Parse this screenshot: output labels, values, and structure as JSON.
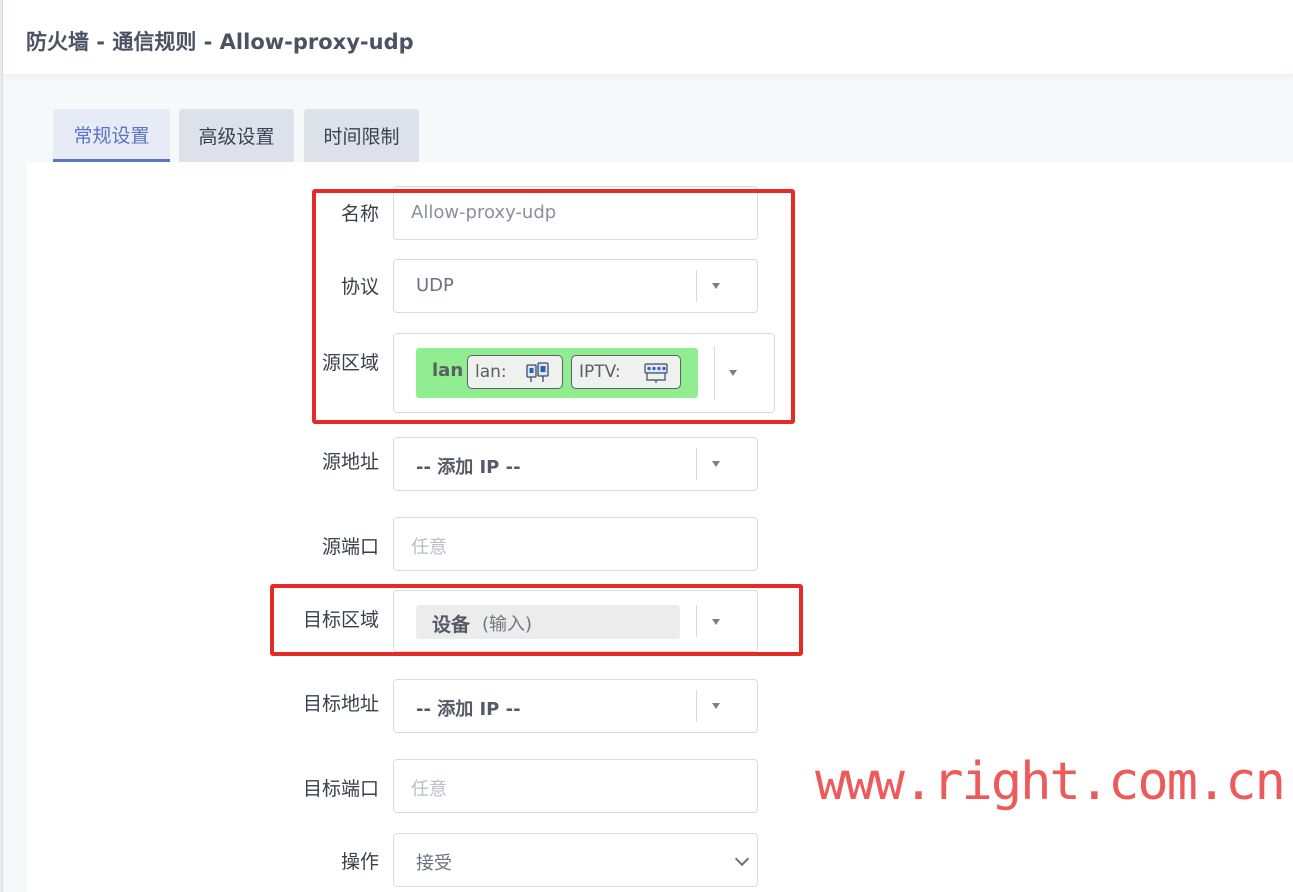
{
  "modal": {
    "title": "防火墙 - 通信规则 - Allow-proxy-udp"
  },
  "tabs": [
    {
      "label": "常规设置",
      "active": true
    },
    {
      "label": "高级设置",
      "active": false
    },
    {
      "label": "时间限制",
      "active": false
    }
  ],
  "form": {
    "name": {
      "label": "名称",
      "value": "Allow-proxy-udp"
    },
    "protocol": {
      "label": "协议",
      "value": "UDP"
    },
    "source_zone": {
      "label": "源区域",
      "zone": "lan",
      "color": "#90ee90",
      "networks": [
        {
          "name": "lan:",
          "icon": "ethernet-port-icon"
        },
        {
          "name": "IPTV:",
          "icon": "ethernet-switch-icon"
        }
      ]
    },
    "source_address": {
      "label": "源地址",
      "value": "-- 添加 IP --"
    },
    "source_port": {
      "label": "源端口",
      "placeholder": "任意"
    },
    "dest_zone": {
      "label": "目标区域",
      "zone": "设备",
      "sub": "(输入)"
    },
    "dest_address": {
      "label": "目标地址",
      "value": "-- 添加 IP --"
    },
    "dest_port": {
      "label": "目标端口",
      "placeholder": "任意"
    },
    "action": {
      "label": "操作",
      "value": "接受"
    }
  },
  "watermark": "www.right.com.cn",
  "colors": {
    "accent": "#5a74c7",
    "highlight_box": "#e52b26",
    "lan_zone": "#90ee90",
    "watermark": "#ee5a5a"
  }
}
